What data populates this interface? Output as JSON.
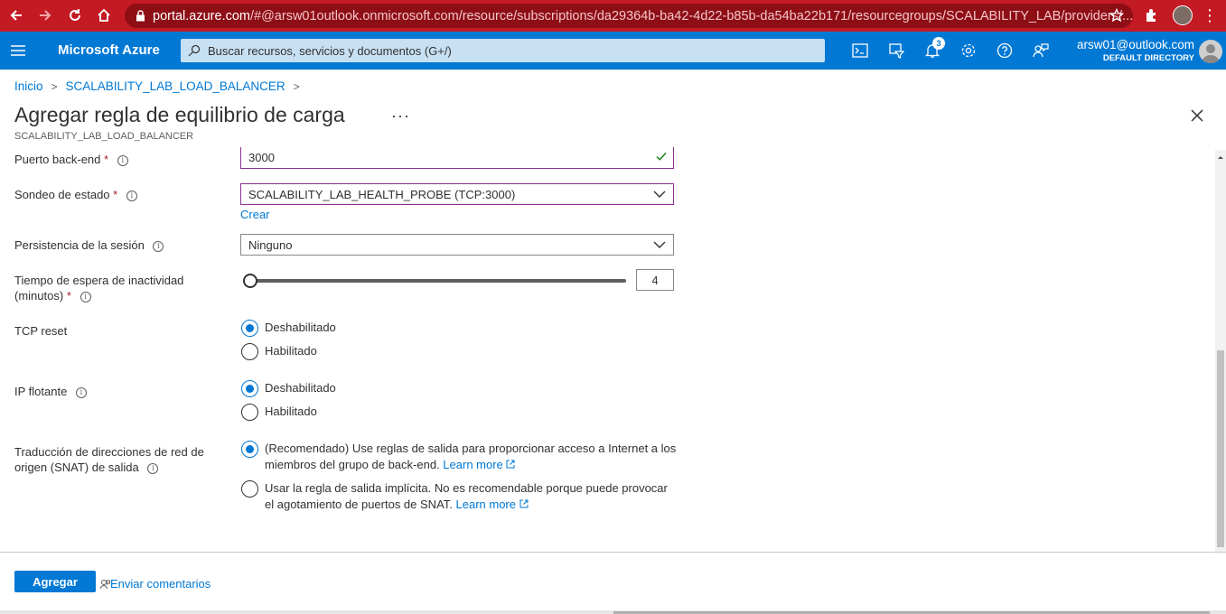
{
  "browser": {
    "url_host": "portal.azure.com",
    "url_path": "/#@arsw01outlook.onmicrosoft.com/resource/subscriptions/da29364b-ba42-4d22-b85b-da54ba22b171/resourcegroups/SCALABILITY_LAB/providers/..."
  },
  "header": {
    "brand": "Microsoft Azure",
    "search_placeholder": "Buscar recursos, servicios y documentos (G+/)",
    "notifications_count": "3",
    "account_email": "arsw01@outlook.com",
    "account_directory": "DEFAULT DIRECTORY"
  },
  "breadcrumb": {
    "items": [
      "Inicio",
      "SCALABILITY_LAB_LOAD_BALANCER"
    ]
  },
  "blade": {
    "title": "Agregar regla de equilibrio de carga",
    "more": "···",
    "subtitle": "SCALABILITY_LAB_LOAD_BALANCER"
  },
  "form": {
    "backend_port": {
      "label": "Puerto back-end",
      "value": "3000"
    },
    "health_probe": {
      "label": "Sondeo de estado",
      "value": "SCALABILITY_LAB_HEALTH_PROBE (TCP:3000)",
      "create_link": "Crear"
    },
    "session_persistence": {
      "label": "Persistencia de la sesión",
      "value": "Ninguno"
    },
    "idle_timeout": {
      "label_line1": "Tiempo de espera de inactividad",
      "label_line2": "(minutos)",
      "value": "4",
      "fraction": 0.0
    },
    "tcp_reset": {
      "label": "TCP reset",
      "options": [
        "Deshabilitado",
        "Habilitado"
      ],
      "selected": "Deshabilitado"
    },
    "floating_ip": {
      "label": "IP flotante",
      "options": [
        "Deshabilitado",
        "Habilitado"
      ],
      "selected": "Deshabilitado"
    },
    "snat": {
      "label_line1": "Traducción de direcciones de red de",
      "label_line2": "origen (SNAT) de salida",
      "option1_line1": "(Recomendado) Use reglas de salida para proporcionar acceso a Internet a los",
      "option1_line2": "miembros del grupo de back-end.",
      "option2_line1": "Usar la regla de salida implícita. No es recomendable porque puede provocar",
      "option2_line2": "el agotamiento de puertos de SNAT.",
      "learn_more": "Learn more",
      "selected": "option1"
    },
    "required_mark": "*"
  },
  "footer": {
    "add_button": "Agregar",
    "feedback_link": "Enviar comentarios"
  },
  "colors": {
    "browser_bar": "#c41a24",
    "azure_blue": "#0078d4",
    "field_focus_border": "#8b2f91"
  }
}
